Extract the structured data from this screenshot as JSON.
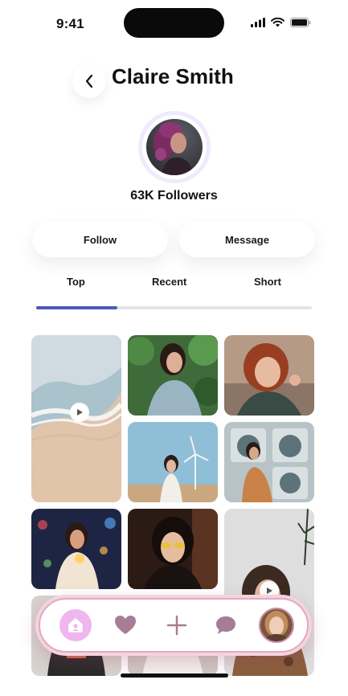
{
  "status_bar": {
    "time": "9:41"
  },
  "header": {
    "title": "Claire Smith"
  },
  "profile": {
    "followers": "63K Followers"
  },
  "actions": {
    "follow_label": "Follow",
    "message_label": "Message"
  },
  "tabs": [
    {
      "label": "Top",
      "active": true
    },
    {
      "label": "Recent",
      "active": false
    },
    {
      "label": "Short",
      "active": false
    }
  ],
  "gallery": [
    {
      "subject": "ocean waves on sand",
      "video": true
    },
    {
      "subject": "woman in blue coat among leaves",
      "video": false
    },
    {
      "subject": "smiling woman with red hair",
      "video": false
    },
    {
      "subject": "woman near wind turbine",
      "video": false
    },
    {
      "subject": "woman seated at laundromat",
      "video": false
    },
    {
      "subject": "woman with sparkler at night",
      "video": false
    },
    {
      "subject": "woman with yellow sunglasses",
      "video": false
    },
    {
      "subject": "woman under palm trees",
      "video": true
    }
  ],
  "bottom_nav": {
    "items": [
      "home-icon",
      "heart-icon",
      "plus-icon",
      "chat-icon",
      "profile-avatar"
    ],
    "active": "home"
  },
  "colors": {
    "tab_indicator": "#4e5ab8",
    "nav_border": "#e7a6bf",
    "home_active": "#efb6f0",
    "nav_icon": "#a77c95"
  }
}
